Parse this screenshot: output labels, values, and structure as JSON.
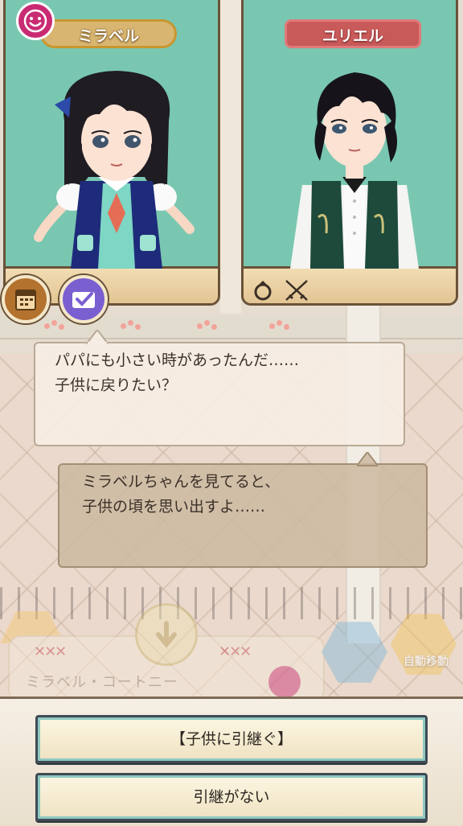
{
  "characters": {
    "left": {
      "name": "ミラベル"
    },
    "right": {
      "name": "ユリエル"
    }
  },
  "dialogue": {
    "parent_lines": [
      "パパにも小さい時があったんだ……",
      "子供に戻りたい？"
    ],
    "child_lines": [
      "ミラベルちゃんを見てると、",
      "子供の頃を思い出すよ……"
    ]
  },
  "hud": {
    "card_name": "ミラベル・コートニー",
    "auto_move_label": "自動移動",
    "card_decoration": "✕✕✕"
  },
  "choices": [
    {
      "label": "【子供に引継ぐ】"
    },
    {
      "label": "引継がない"
    }
  ],
  "icons": {
    "top_badge": "smiley-icon",
    "left_status": [
      "calendar-icon",
      "checkmark-icon"
    ],
    "right_status": [
      "ring-icon",
      "crossed-swords-icon"
    ]
  },
  "colors": {
    "portrait_bg": "#79c7b0",
    "left_nameplate": "#d8b571",
    "right_nameplate": "#c95a5a",
    "button_border": "#3f4a55"
  }
}
